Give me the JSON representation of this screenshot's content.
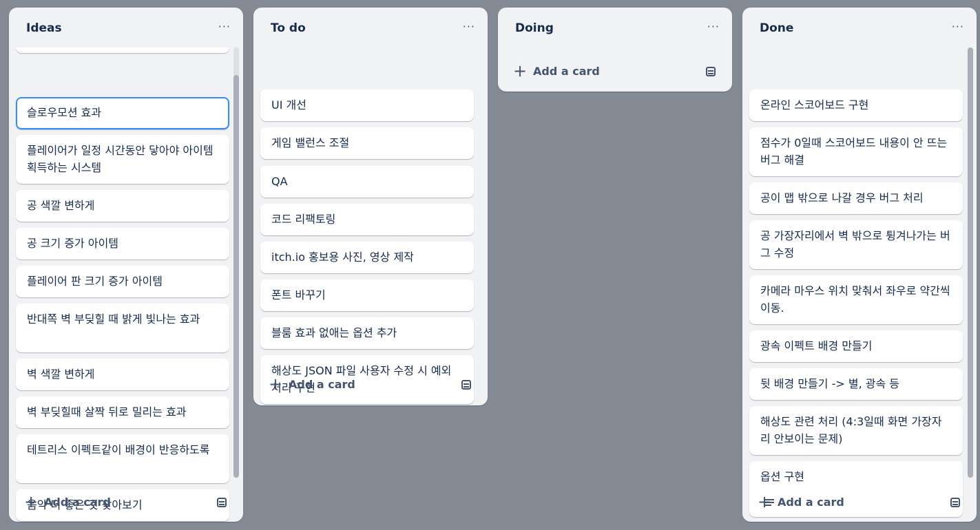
{
  "lists": [
    {
      "title": "Ideas",
      "menu": "···",
      "add_label": "Add a card",
      "cards": [
        "슬로우모션 효과",
        "플레이어가 일정 시간동안 닿아야 아이템 획득하는 시스템",
        "공 색깔 변하게",
        "공 크기 증가 아이템",
        "플레이어 판 크기 증가 아이템",
        "반대쪽 벽 부딪힐 때 밝게 빛나는 효과",
        "벽 색깔 변하게",
        "벽 부딪힐때 살짝 뒤로 밀리는 효과",
        "테트리스 이펙트같이 배경이 반응하도록",
        "음악 더 좋은 것 찾아보기"
      ]
    },
    {
      "title": "To do",
      "menu": "···",
      "add_label": "Add a card",
      "cards": [
        "UI 개선",
        "게임 밸런스 조절",
        "QA",
        "코드 리팩토링",
        "itch.io 홍보용 사진, 영상 제작",
        "폰트 바꾸기",
        "블룸 효과 없애는 옵션 추가",
        "해상도 JSON 파일 사용자 수정 시 예외 처리 구현"
      ]
    },
    {
      "title": "Doing",
      "menu": "···",
      "add_label": "Add a card",
      "cards": []
    },
    {
      "title": "Done",
      "menu": "···",
      "add_label": "Add a card",
      "cards": [
        "온라인 스코어보드 구현",
        "점수가 0일때 스코어보드 내용이 안 뜨는 버그 해결",
        "공이 맵 밖으로 나갈 경우 버그 처리",
        "공 가장자리에서 벽 밖으로 튕겨나가는 버그 수정",
        "카메라 마우스 위치 맞춰서 좌우로 약간씩 이동.",
        "광속 이펙트 배경 만들기",
        "뒷 배경 만들기 -> 별, 광속 등",
        "해상도 관련 처리 (4:3일때 화면 가장자리 안보이는 문제)",
        "옵션 구현"
      ]
    }
  ],
  "icons": {
    "add": "plus-icon",
    "template": "card-template-icon",
    "menu": "ellipsis-icon",
    "description": "description-icon"
  },
  "colors": {
    "board_background": "#838a93",
    "list_background": "#f1f2f4",
    "focus_ring": "#388bff"
  }
}
